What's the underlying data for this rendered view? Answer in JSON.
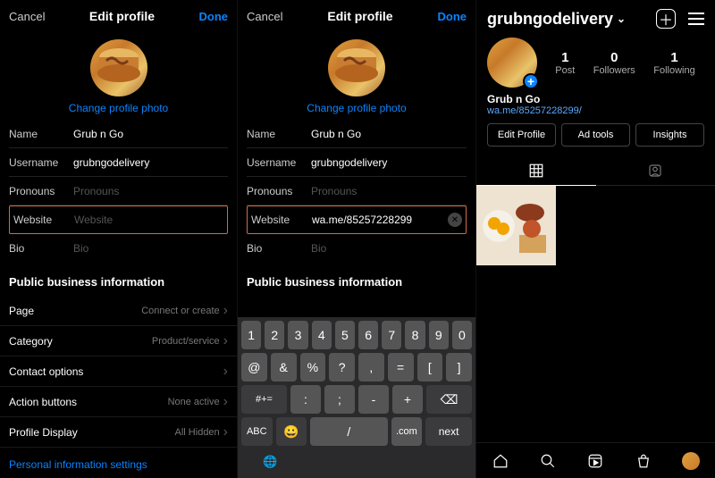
{
  "p1": {
    "cancel": "Cancel",
    "title": "Edit profile",
    "done": "Done",
    "change_photo": "Change profile photo",
    "fields": {
      "name_lbl": "Name",
      "name_val": "Grub n Go",
      "username_lbl": "Username",
      "username_val": "grubngodelivery",
      "pronouns_lbl": "Pronouns",
      "pronouns_ph": "Pronouns",
      "website_lbl": "Website",
      "website_ph": "Website",
      "bio_lbl": "Bio",
      "bio_ph": "Bio"
    },
    "section": "Public business information",
    "rows": {
      "page_lbl": "Page",
      "page_val": "Connect or create",
      "category_lbl": "Category",
      "category_val": "Product/service",
      "contact_lbl": "Contact options",
      "contact_val": "",
      "action_lbl": "Action buttons",
      "action_val": "None active",
      "display_lbl": "Profile Display",
      "display_val": "All Hidden"
    },
    "personal": "Personal information settings"
  },
  "p2": {
    "cancel": "Cancel",
    "title": "Edit profile",
    "done": "Done",
    "change_photo": "Change profile photo",
    "fields": {
      "name_lbl": "Name",
      "name_val": "Grub n Go",
      "username_lbl": "Username",
      "username_val": "grubngodelivery",
      "pronouns_lbl": "Pronouns",
      "pronouns_ph": "Pronouns",
      "website_lbl": "Website",
      "website_val": "wa.me/85257228299",
      "bio_lbl": "Bio",
      "bio_ph": "Bio"
    },
    "section": "Public business information",
    "keyboard": {
      "r1": [
        "1",
        "2",
        "3",
        "4",
        "5",
        "6",
        "7",
        "8",
        "9",
        "0"
      ],
      "r2": [
        "@",
        "&",
        "%",
        "?",
        ",",
        "=",
        "[",
        "]"
      ],
      "r3_shift": "#+=",
      "r3": [
        "_",
        "\\",
        "|",
        "~",
        "<",
        ">",
        "€",
        "£",
        "¥",
        "•",
        ".com"
      ],
      "r3_mid": [
        ":",
        ";",
        "-",
        "+"
      ],
      "r3_back": "⌫",
      "r4_abc": "ABC",
      "r4_emoji": "😀",
      "r4_slash": "/",
      "r4_com": ".com",
      "r4_next": "next",
      "globe": "🌐"
    }
  },
  "p3": {
    "username": "grubngodelivery",
    "stats": {
      "posts_n": "1",
      "posts_l": "Post",
      "followers_n": "0",
      "followers_l": "Followers",
      "following_n": "1",
      "following_l": "Following"
    },
    "bio_name": "Grub n Go",
    "bio_url": "wa.me/85257228299/",
    "buttons": {
      "edit": "Edit Profile",
      "ad": "Ad tools",
      "insights": "Insights"
    }
  }
}
